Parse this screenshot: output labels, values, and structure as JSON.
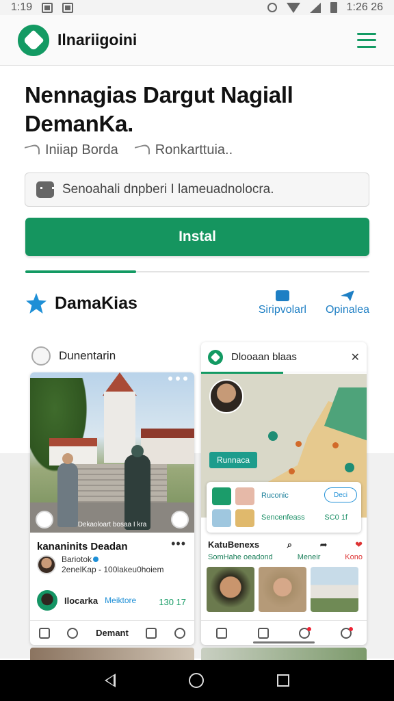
{
  "status_bar": {
    "time_left": "1:19",
    "time_right": "1:26 26"
  },
  "header": {
    "app_name": "Ilnariigoini"
  },
  "page": {
    "title": "Nennagias Dargut Nagiall DemanKa.",
    "meta": [
      {
        "label": "Iniiap Borda"
      },
      {
        "label": "Ronkarttuia.."
      }
    ]
  },
  "search": {
    "value": "Senoahali dnpberi I lameuadnolocra."
  },
  "install": {
    "label": "Instal"
  },
  "section": {
    "title": "DamaKias",
    "actions": [
      {
        "label": "Siripvolarl"
      },
      {
        "label": "Opinalea"
      }
    ]
  },
  "card_left": {
    "author": "Dunentarin",
    "photo_caption": "Dekaoloart bosaa I kra",
    "post_title": "kananinits Deadan",
    "post_author": "Bariotok",
    "post_meta": "2enelKap - 100lakeu0hoiem",
    "reply_name": "Ilocarka",
    "reply_sub": "Meiktore",
    "reply_count": "130 17",
    "bottom_nav_label": "Demant"
  },
  "card_right": {
    "title": "Dlooaan blaas",
    "map_pill": "Runnaca",
    "panel_title": "Ruconic",
    "panel_sub": "Sencenfeass",
    "panel_count": "SC0 1f",
    "panel_tag": "Deci",
    "action_name": "KatuBenexs",
    "action_sub_1": "SomHahe oeadond",
    "action_sub_2": "Meneir",
    "action_sub_3": "Kono"
  },
  "colors": {
    "accent": "#15955f",
    "link": "#1e7fc4",
    "badge": "#e22233"
  }
}
